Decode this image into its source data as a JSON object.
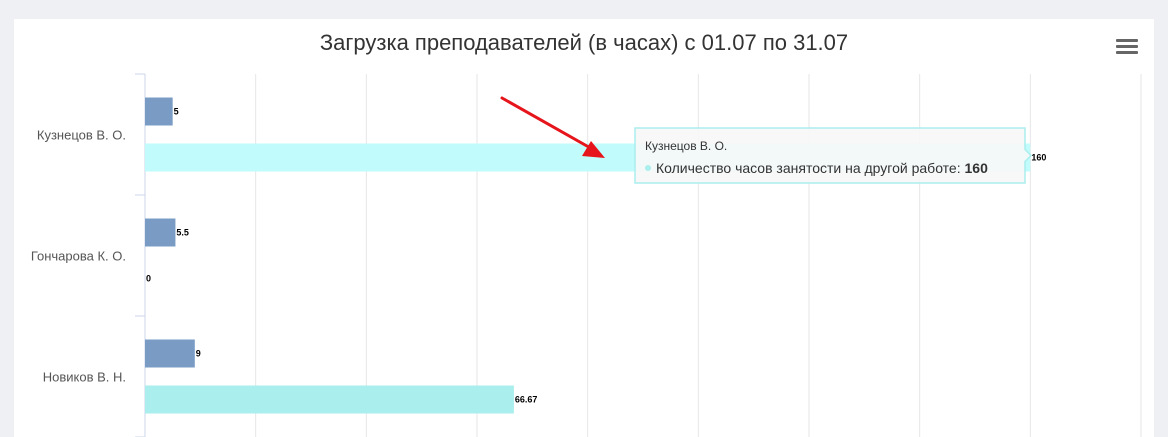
{
  "chart_data": {
    "type": "bar",
    "orientation": "horizontal",
    "title": "Загрузка преподавателей (в часах) с 01.07 по 31.07",
    "categories": [
      "Кузнецов В. О.",
      "Гончарова К. О.",
      "Новиков В. Н."
    ],
    "series": [
      {
        "values": [
          5,
          5.5,
          9
        ],
        "labels": [
          "5",
          "5.5",
          "9"
        ],
        "color": "#7a9cc4"
      },
      {
        "name": "Количество часов занятости на другой работе",
        "values": [
          160,
          0,
          66.67
        ],
        "labels": [
          "160",
          "0",
          "66.67"
        ],
        "color": "#aaeeee",
        "highlight_color": "#c2fbfb"
      }
    ],
    "xlim": [
      0,
      180
    ],
    "grid": true,
    "tooltip": {
      "header": "Кузнецов В. О.",
      "series_name": "Количество часов занятости на другой работе",
      "value": "160",
      "category_index": 0,
      "series_index": 1
    }
  },
  "colors": {
    "background": "#eef0f3",
    "card": "#ffffff",
    "grid": "#e6e6e6",
    "axis": "#ccd6eb",
    "arrow": "#e5151b",
    "tooltip_border": "#aaeeee"
  },
  "icons": {
    "menu": "hamburger-menu-icon",
    "annotation": "red-arrow-icon"
  }
}
